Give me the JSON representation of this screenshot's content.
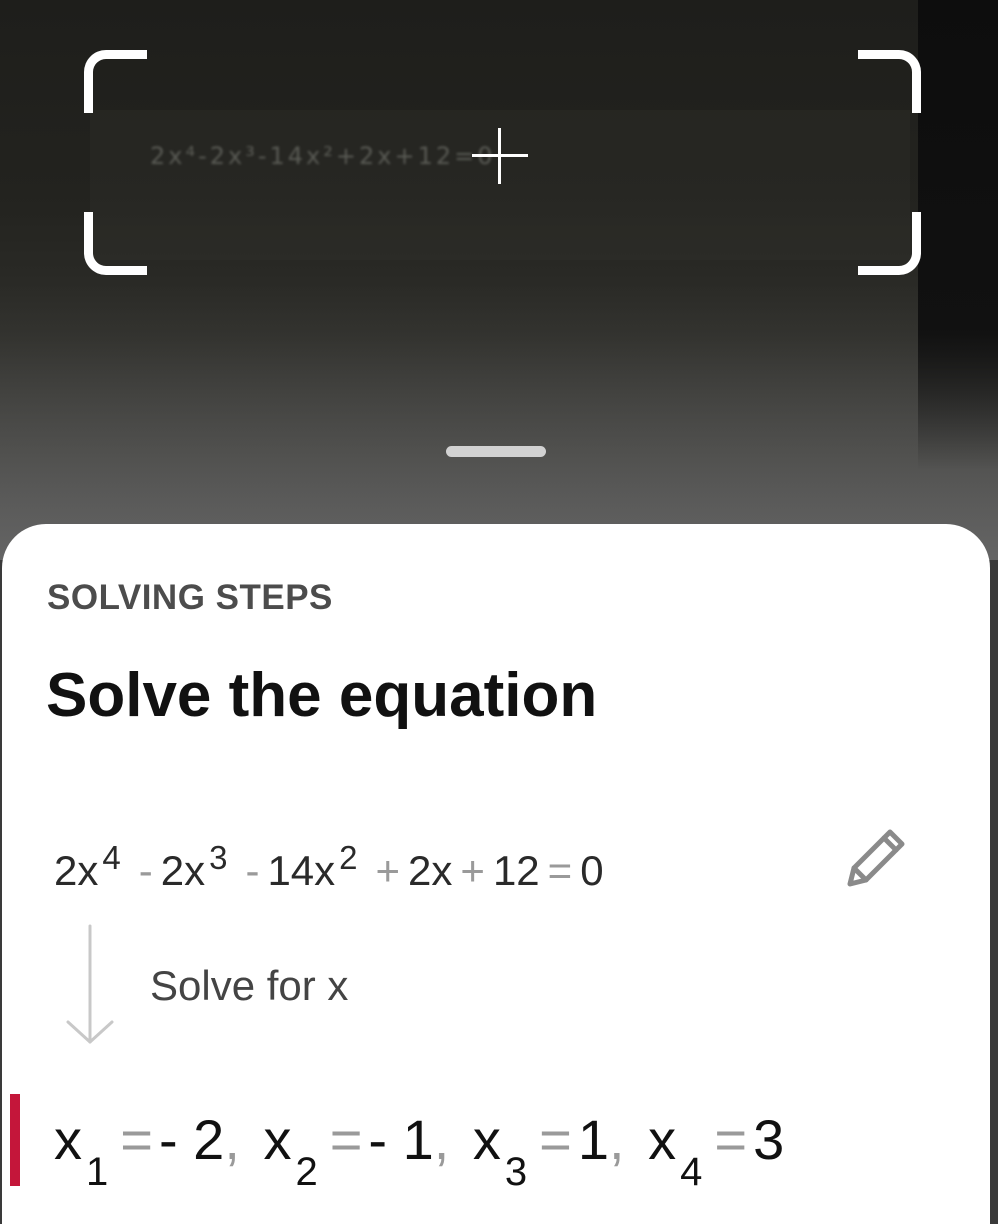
{
  "camera": {
    "captured_text": "2x⁴-2x³-14x²+2x+12=0"
  },
  "sheet": {
    "section_label": "SOLVING STEPS",
    "title": "Solve the equation",
    "equation": {
      "t1_coef": "2x",
      "t1_exp": "4",
      "op1": "-",
      "t2_coef": "2x",
      "t2_exp": "3",
      "op2": "-",
      "t3_coef": "14x",
      "t3_exp": "2",
      "op3": "+",
      "t4": "2x",
      "op4": "+",
      "t5": "12",
      "eq": "=",
      "rhs": "0"
    },
    "step_text": "Solve for x",
    "result": {
      "r1_var": "x",
      "r1_sub": "1",
      "r1_eq": "=",
      "r1_val": "- 2",
      "sep1": ",",
      "r2_var": "x",
      "r2_sub": "2",
      "r2_eq": "=",
      "r2_val": "- 1",
      "sep2": ",",
      "r3_var": "x",
      "r3_sub": "3",
      "r3_eq": "=",
      "r3_val": "1",
      "sep3": ",",
      "r4_var": "x",
      "r4_sub": "4",
      "r4_eq": "=",
      "r4_val": "3"
    }
  },
  "icons": {
    "edit": "pencil-icon",
    "step": "arrow-down-icon",
    "crosshair": "crosshair-icon",
    "scan_frame": "scan-frame-icon"
  },
  "colors": {
    "accent": "#c4163a",
    "sheet_bg": "#ffffff",
    "operator_gray": "#9a9a9a"
  }
}
